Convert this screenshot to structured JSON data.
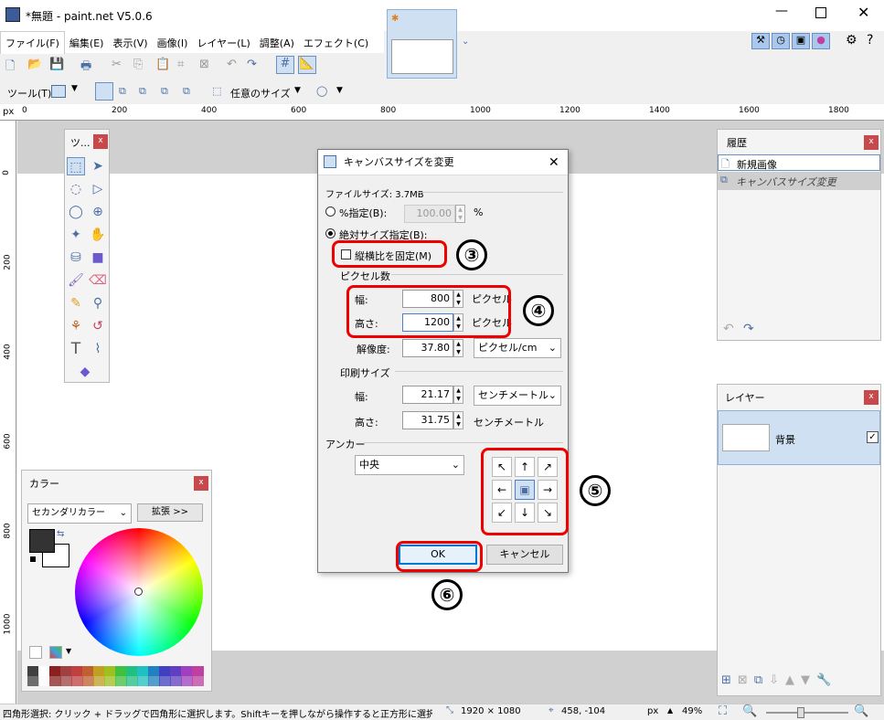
{
  "window": {
    "title": "*無題 - paint.net V5.0.6"
  },
  "menu": [
    "ファイル(F)",
    "編集(E)",
    "表示(V)",
    "画像(I)",
    "レイヤー(L)",
    "調整(A)",
    "エフェクト(C)"
  ],
  "toolbar2": {
    "tool_label": "ツール(T):",
    "size_label": "任意のサイズ"
  },
  "ruler": {
    "unit": "px",
    "h_ticks": [
      "0",
      "200",
      "400",
      "600",
      "800",
      "1000",
      "1200",
      "1400",
      "1600",
      "1800"
    ],
    "v_ticks": [
      "0",
      "200",
      "400",
      "600",
      "800",
      "1000"
    ]
  },
  "tools_panel": {
    "title": "ツ..."
  },
  "history": {
    "title": "履歴",
    "items": [
      "新規画像",
      "キャンバスサイズ変更"
    ]
  },
  "layers": {
    "title": "レイヤー",
    "items": [
      {
        "name": "背景",
        "checked": true
      }
    ]
  },
  "colors": {
    "title": "カラー",
    "mode": "セカンダリカラー",
    "expand": "拡張 >>",
    "primary": "#333333",
    "secondary": "#ffffff",
    "palette": [
      "#404040",
      "#ffffff",
      "#8b2020",
      "#a04040",
      "#c04040",
      "#c06030",
      "#c0a020",
      "#a0c020",
      "#40c040",
      "#20c080",
      "#20c0c0",
      "#2080c0",
      "#4040c0",
      "#6040c0",
      "#a040c0",
      "#c040a0"
    ]
  },
  "dialog": {
    "title": "キャンバスサイズを変更",
    "file_size": "ファイルサイズ: 3.7MB",
    "percent_label": "%指定(B):",
    "percent_value": "100.00",
    "percent_unit": "%",
    "absolute_label": "絶対サイズ指定(B):",
    "keep_aspect": "縦横比を固定(M)",
    "pixel_group": "ピクセル数",
    "width_label": "幅:",
    "width_value": "800",
    "height_label": "高さ:",
    "height_value": "1200",
    "pixel_unit": "ピクセル",
    "resolution_label": "解像度:",
    "resolution_value": "37.80",
    "resolution_unit": "ピクセル/cm",
    "print_group": "印刷サイズ",
    "print_width_label": "幅:",
    "print_width_value": "21.17",
    "print_width_unit": "センチメートル",
    "print_height_label": "高さ:",
    "print_height_value": "31.75",
    "print_height_unit": "センチメートル",
    "anchor_group": "アンカー",
    "anchor_value": "中央",
    "ok": "OK",
    "cancel": "キャンセル"
  },
  "annotations": {
    "n3": "③",
    "n4": "④",
    "n5": "⑤",
    "n6": "⑥"
  },
  "status": {
    "hint": "四角形選択: クリック + ドラッグで四角形に選択します。Shiftキーを押しながら操作すると正方形に選択します。",
    "size": "1920 × 1080",
    "pos": "458, -104",
    "unit": "px",
    "zoom": "49%"
  }
}
